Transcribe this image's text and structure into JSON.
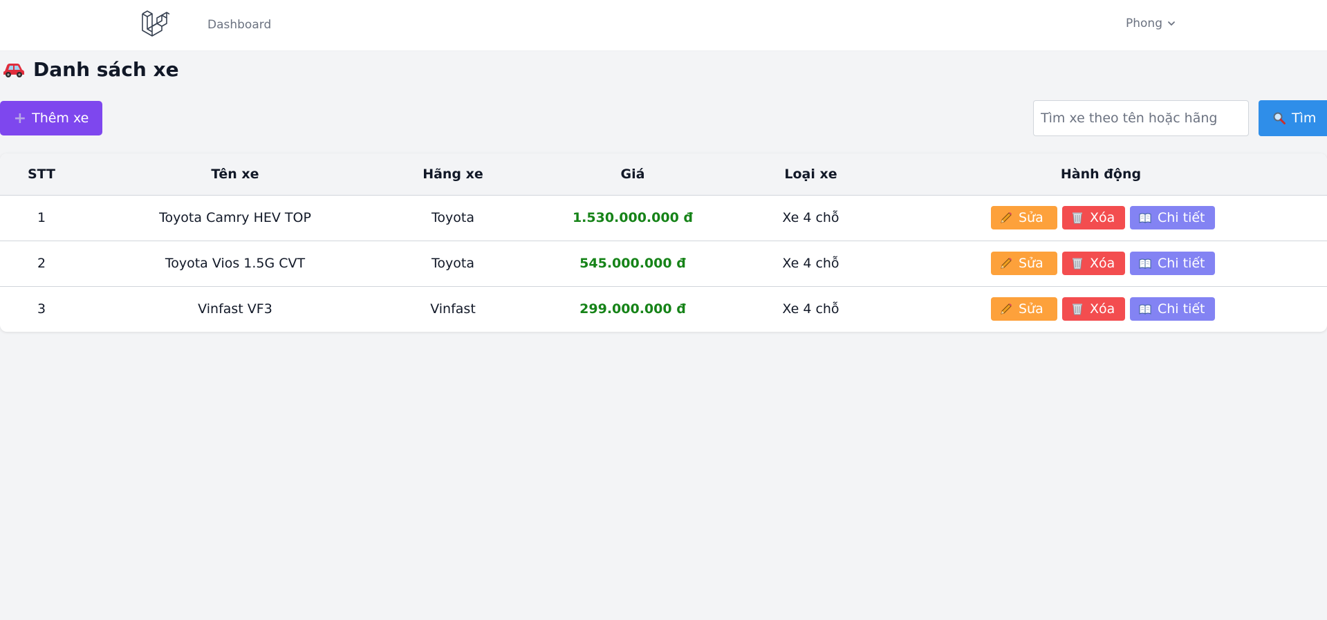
{
  "nav": {
    "dashboard": "Dashboard",
    "user": "Phong"
  },
  "page": {
    "title": "Danh sách xe"
  },
  "toolbar": {
    "add_label": "Thêm xe",
    "search_placeholder": "Tìm xe theo tên hoặc hãng",
    "search_value": "",
    "search_label": "Tìm"
  },
  "table": {
    "headers": [
      "STT",
      "Tên xe",
      "Hãng xe",
      "Giá",
      "Loại xe",
      "Hành động"
    ],
    "rows": [
      {
        "stt": "1",
        "name": "Toyota Camry HEV TOP",
        "brand": "Toyota",
        "price": "1.530.000.000 đ",
        "type": "Xe 4 chỗ"
      },
      {
        "stt": "2",
        "name": "Toyota Vios 1.5G CVT",
        "brand": "Toyota",
        "price": "545.000.000 đ",
        "type": "Xe 4 chỗ"
      },
      {
        "stt": "3",
        "name": "Vinfast VF3",
        "brand": "Vinfast",
        "price": "299.000.000 đ",
        "type": "Xe 4 chỗ"
      }
    ],
    "actions": {
      "edit": "Sửa",
      "delete": "Xóa",
      "detail": "Chi tiết"
    }
  },
  "icons": {
    "logo": "laravel-logo-icon",
    "dropdown": "chevron-down-icon",
    "title": "red-car-icon",
    "add": "plus-icon",
    "search": "magnifier-icon",
    "edit": "pencil-icon",
    "delete": "wastebasket-icon",
    "detail": "open-book-icon"
  },
  "colors": {
    "add_button": "#7e47ee",
    "search_button": "#2f8ee9",
    "edit_button": "#fda13b",
    "delete_button": "#f34d4f",
    "detail_button": "#8383f3",
    "price_text": "#168318"
  }
}
